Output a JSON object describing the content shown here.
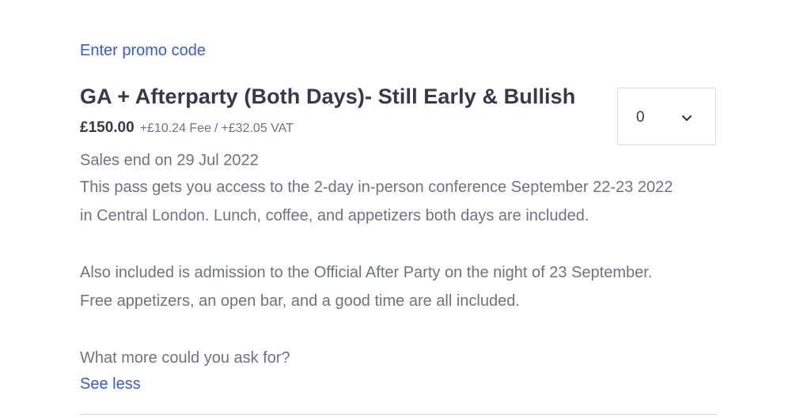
{
  "promo": {
    "link_label": "Enter promo code"
  },
  "ticket": {
    "title": "GA + Afterparty (Both Days)- Still Early & Bullish",
    "price": "£150.00",
    "fee": "+£10.24 Fee",
    "separator": "/",
    "vat": "+£32.05 VAT",
    "sales_end": "Sales end on 29 Jul 2022",
    "description": {
      "line1": "This pass gets you access to the 2-day in-person conference September 22-23 2022",
      "line2": "in Central London. Lunch, coffee, and appetizers both days are included.",
      "line3": "Also included is admission to the Official After Party on the night of 23 September.",
      "line4": "Free appetizers, an open bar, and a good time are all included.",
      "line5": "What more could you ask for?"
    },
    "see_less_label": "See less"
  },
  "quantity": {
    "selected": "0",
    "icon": "chevron-down-icon"
  },
  "colors": {
    "link": "#3659e3",
    "heading": "#39364f",
    "body_text": "#6f7287",
    "border": "#dbdae3"
  }
}
